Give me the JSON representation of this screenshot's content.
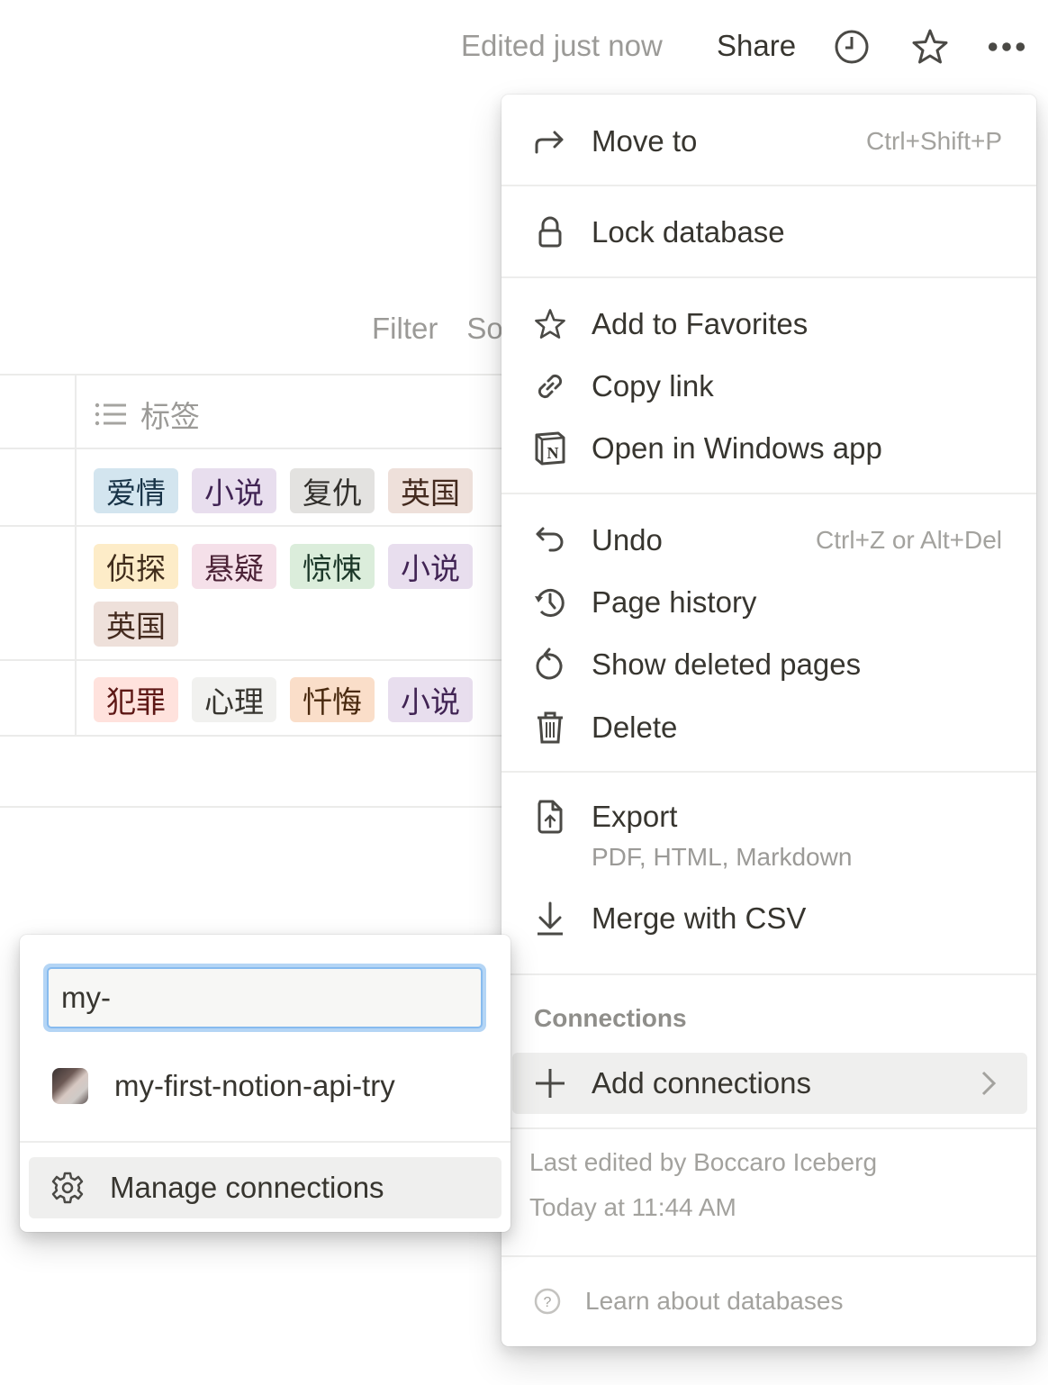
{
  "topbar": {
    "edited_status": "Edited just now",
    "share_label": "Share",
    "icons": [
      "clock-icon",
      "star-icon",
      "more-icon"
    ]
  },
  "database": {
    "view_controls": {
      "filter_label": "Filter",
      "sort_label_partial": "So"
    },
    "column_header": {
      "icon": "list-icon",
      "label": "标签"
    },
    "rows": [
      {
        "tags": [
          {
            "label": "爱情",
            "bg": "#d3e5ef",
            "fg": "#183347"
          },
          {
            "label": "小说",
            "bg": "#e8deee",
            "fg": "#412454"
          },
          {
            "label": "复仇",
            "bg": "#e3e2e0",
            "fg": "#32302c"
          },
          {
            "label": "英国",
            "bg": "#eee0da",
            "fg": "#442a1e"
          }
        ]
      },
      {
        "tags": [
          {
            "label": "侦探",
            "bg": "#fdecc8",
            "fg": "#402c1b"
          },
          {
            "label": "悬疑",
            "bg": "#f5e0e9",
            "fg": "#4c2337"
          },
          {
            "label": "惊悚",
            "bg": "#dbeddb",
            "fg": "#1c3829"
          },
          {
            "label": "小说",
            "bg": "#e8deee",
            "fg": "#412454"
          },
          {
            "label": "英国",
            "bg": "#eee0da",
            "fg": "#442a1e"
          }
        ]
      },
      {
        "tags": [
          {
            "label": "犯罪",
            "bg": "#ffe2dd",
            "fg": "#5d1715"
          },
          {
            "label": "心理",
            "bg": "#f1f1ef",
            "fg": "#37352f"
          },
          {
            "label": "忏悔",
            "bg": "#fadec9",
            "fg": "#49290e"
          },
          {
            "label": "小说",
            "bg": "#e8deee",
            "fg": "#412454"
          }
        ]
      }
    ]
  },
  "menu": {
    "items": {
      "move_to": {
        "label": "Move to",
        "shortcut": "Ctrl+Shift+P",
        "icon": "arrow-turn-right-icon"
      },
      "lock": {
        "label": "Lock database",
        "icon": "lock-icon"
      },
      "favorites": {
        "label": "Add to Favorites",
        "icon": "star-icon"
      },
      "copy_link": {
        "label": "Copy link",
        "icon": "link-icon"
      },
      "open_app": {
        "label": "Open in Windows app",
        "icon": "notion-logo-icon"
      },
      "undo": {
        "label": "Undo",
        "shortcut": "Ctrl+Z or Alt+Del",
        "icon": "undo-icon"
      },
      "page_history": {
        "label": "Page history",
        "icon": "history-icon"
      },
      "show_deleted": {
        "label": "Show deleted pages",
        "icon": "restore-icon"
      },
      "delete": {
        "label": "Delete",
        "icon": "trash-icon"
      },
      "export": {
        "label": "Export",
        "sublabel": "PDF, HTML, Markdown",
        "icon": "export-file-icon"
      },
      "merge_csv": {
        "label": "Merge with CSV",
        "icon": "download-arrow-icon"
      },
      "add_connections": {
        "label": "Add connections",
        "icon": "plus-icon"
      }
    },
    "connections_header": "Connections",
    "last_edited_by": "Last edited by Boccaro Iceberg",
    "last_edited_time": "Today at 11:44 AM",
    "learn_link": "Learn about databases"
  },
  "connections_popup": {
    "search_value": "my-",
    "results": [
      {
        "name": "my-first-notion-api-try",
        "icon": "integration-avatar"
      }
    ],
    "manage_label": "Manage connections"
  },
  "colors": {
    "text_primary": "#37352f",
    "text_secondary": "#9b9a97",
    "hover_bg": "#efefee",
    "focus_ring": "#87bbef"
  }
}
